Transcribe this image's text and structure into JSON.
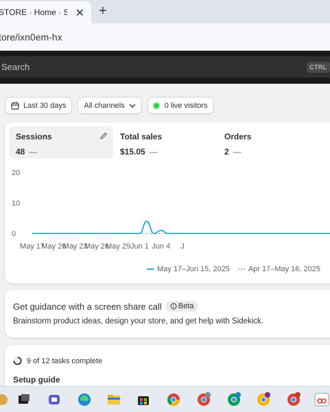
{
  "browser": {
    "tab_title": "STORE · Home · Shop",
    "address": "tore/ixn0em-hx"
  },
  "admin": {
    "search_placeholder": "Search",
    "search_shortcut": "CTRL"
  },
  "filters": {
    "date_range": "Last 30 days",
    "channels": "All channels",
    "live_visitors": "0 live visitors"
  },
  "metrics": [
    {
      "label": "Sessions",
      "value": "48",
      "trend": "—"
    },
    {
      "label": "Total sales",
      "value": "$15.05",
      "trend": "—"
    },
    {
      "label": "Orders",
      "value": "2",
      "trend": "—"
    }
  ],
  "chart_data": {
    "type": "line",
    "y_ticks": [
      "20",
      "10",
      "0"
    ],
    "ylim": [
      0,
      20
    ],
    "x_tick_labels": [
      "May 17",
      "May 20",
      "May 23",
      "May 26",
      "May 29",
      "Jun 1",
      "Jun 4",
      "J"
    ],
    "x": [
      "May 17",
      "May 18",
      "May 19",
      "May 20",
      "May 21",
      "May 22",
      "May 23",
      "May 24",
      "May 25",
      "May 26",
      "May 27",
      "May 28",
      "May 29",
      "May 30",
      "May 31",
      "Jun 1",
      "Jun 2",
      "Jun 3",
      "Jun 4",
      "Jun 5",
      "Jun 6",
      "Jun 7"
    ],
    "series": [
      {
        "name": "May 17–Jun 15, 2025",
        "color": "#2aa6d4",
        "style": "solid",
        "values": [
          0,
          0,
          0,
          0,
          0,
          0,
          0,
          0,
          0,
          0,
          0,
          0,
          0,
          0,
          0,
          0,
          4,
          0,
          1,
          0,
          0,
          0
        ]
      },
      {
        "name": "Apr 17–May 16, 2025",
        "color": "#a8b4bb",
        "style": "dotted",
        "values": [
          0,
          0,
          0,
          0,
          0,
          0,
          0,
          0,
          0,
          0,
          0,
          0,
          0,
          0,
          0,
          0,
          0,
          0,
          0,
          0,
          0,
          0
        ]
      }
    ],
    "grid": false,
    "legend": "bottom"
  },
  "guidance": {
    "title": "Get guidance with a screen share call",
    "badge": "Beta",
    "description": "Brainstorm product ideas, design your store, and get help with Sidekick."
  },
  "setup": {
    "tasks_status": "9 of 12 tasks complete",
    "title": "Setup guide"
  },
  "taskbar": {
    "icons": [
      "explorer-icon",
      "task-view-icon",
      "teams-icon",
      "edge-icon",
      "file-explorer-icon",
      "store-icon",
      "chrome-icon",
      "chrome-profile-p-icon",
      "chrome-profile-s-icon",
      "chrome-profile-p2-icon",
      "chrome-profile-g-icon",
      "snipping-tool-icon"
    ]
  }
}
